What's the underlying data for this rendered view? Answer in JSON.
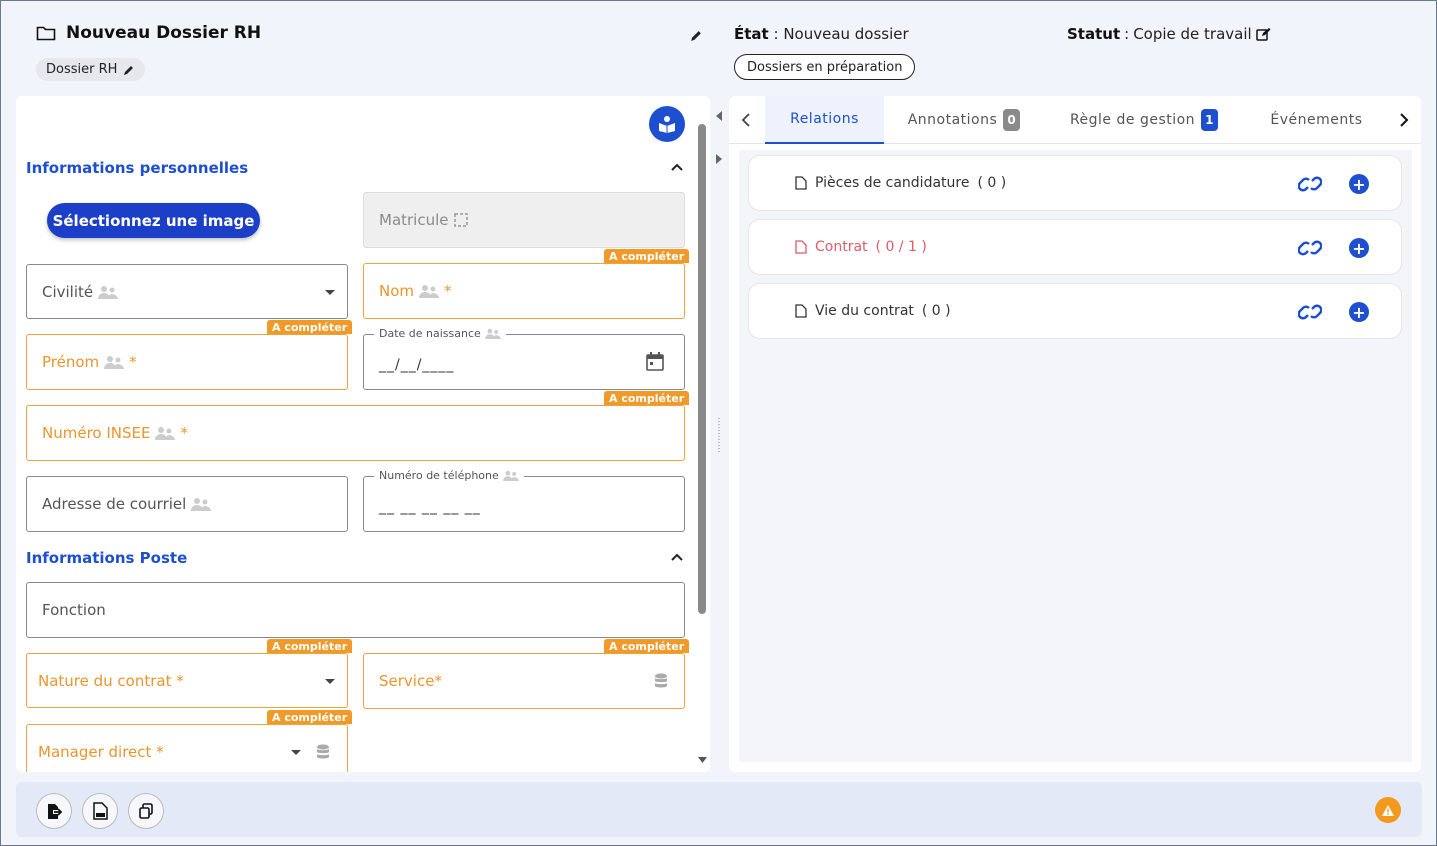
{
  "header": {
    "title": "Nouveau Dossier RH",
    "chip": "Dossier RH",
    "etat_label": "État",
    "etat_value": "Nouveau dossier",
    "statut_label": "Statut",
    "statut_value": "Copie de travail",
    "pill": "Dossiers en préparation"
  },
  "form": {
    "section_personal": "Informations personnelles",
    "section_poste": "Informations Poste",
    "select_image": "Sélectionnez une image",
    "badge": "A compléter",
    "matricule": "Matricule",
    "civilite": "Civilité",
    "nom": "Nom",
    "prenom": "Prénom",
    "date_label": "Date de naissance",
    "date_mask": "__/__/____",
    "insee": "Numéro INSEE",
    "email": "Adresse de courriel",
    "phone_label": "Numéro de téléphone",
    "phone_mask": "__ __ __ __ __",
    "fonction": "Fonction",
    "nature": "Nature du contrat *",
    "service": "Service*",
    "manager": "Manager direct *",
    "required_mark": "*"
  },
  "tabs": [
    {
      "label": "Relations",
      "active": true
    },
    {
      "label": "Annotations",
      "count": "0"
    },
    {
      "label": "Règle de gestion",
      "count": "1"
    },
    {
      "label": "Événements"
    }
  ],
  "relations": [
    {
      "name": "Pièces de candidature",
      "count": "( 0 )"
    },
    {
      "name": "Contrat",
      "count": "( 0 / 1 )",
      "error": true
    },
    {
      "name": "Vie du contrat",
      "count": "( 0 )"
    }
  ],
  "colors": {
    "primary": "#1d4fcf",
    "required": "#f0a23a",
    "error": "#e05a6a",
    "warning": "#f39a1e"
  },
  "icons": {
    "title": "folder-icon",
    "chip": "pencil-icon",
    "statut": "edit-icon",
    "relation_doc": "file-icon",
    "relation_link": "link-icon",
    "relation_add": "plus-icon",
    "footer": [
      "export-icon",
      "pdf-icon",
      "copy-icon"
    ],
    "warning": "warning-icon"
  }
}
